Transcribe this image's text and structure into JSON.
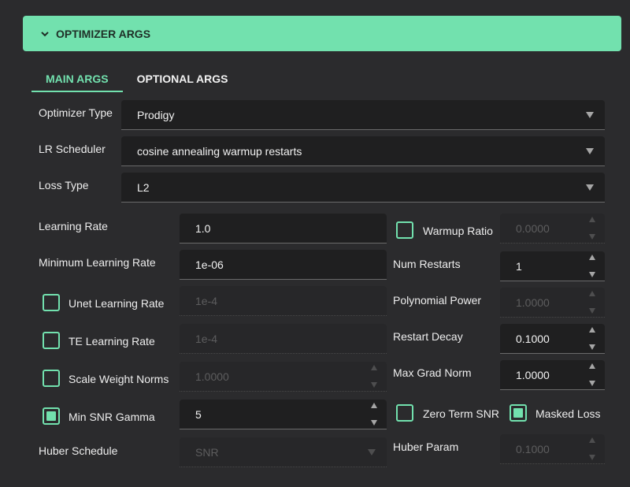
{
  "section": {
    "title": "OPTIMIZER ARGS"
  },
  "tabs": [
    {
      "label": "MAIN ARGS",
      "active": true
    },
    {
      "label": "OPTIONAL ARGS",
      "active": false
    }
  ],
  "selects": {
    "optimizer_type": {
      "label": "Optimizer Type",
      "value": "Prodigy"
    },
    "lr_scheduler": {
      "label": "LR Scheduler",
      "value": "cosine annealing warmup restarts"
    },
    "loss_type": {
      "label": "Loss Type",
      "value": "L2"
    },
    "huber_schedule": {
      "label": "Huber Schedule",
      "value": "SNR"
    }
  },
  "left_fields": {
    "learning_rate": {
      "label": "Learning Rate",
      "value": "1.0"
    },
    "min_learning_rate": {
      "label": "Minimum Learning Rate",
      "value": "1e-06"
    },
    "unet_lr": {
      "label": "Unet Learning Rate",
      "value": "1e-4",
      "checked": false
    },
    "te_lr": {
      "label": "TE Learning Rate",
      "value": "1e-4",
      "checked": false
    },
    "scale_weight_norms": {
      "label": "Scale Weight Norms",
      "value": "1.0000",
      "checked": false
    },
    "min_snr_gamma": {
      "label": "Min SNR Gamma",
      "value": "5",
      "checked": true
    }
  },
  "right_fields": {
    "warmup_ratio": {
      "label": "Warmup Ratio",
      "value": "0.0000",
      "checked": false
    },
    "num_restarts": {
      "label": "Num Restarts",
      "value": "1"
    },
    "polynomial_power": {
      "label": "Polynomial Power",
      "value": "1.0000"
    },
    "restart_decay": {
      "label": "Restart Decay",
      "value": "0.1000"
    },
    "max_grad_norm": {
      "label": "Max Grad Norm",
      "value": "1.0000"
    },
    "zero_term_snr": {
      "label": "Zero Term SNR",
      "checked": false
    },
    "masked_loss": {
      "label": "Masked Loss",
      "checked": true
    },
    "huber_param": {
      "label": "Huber Param",
      "value": "0.1000"
    }
  },
  "colors": {
    "accent": "#72e1ae",
    "background": "#2b2b2d",
    "field": "#1f1f20"
  }
}
